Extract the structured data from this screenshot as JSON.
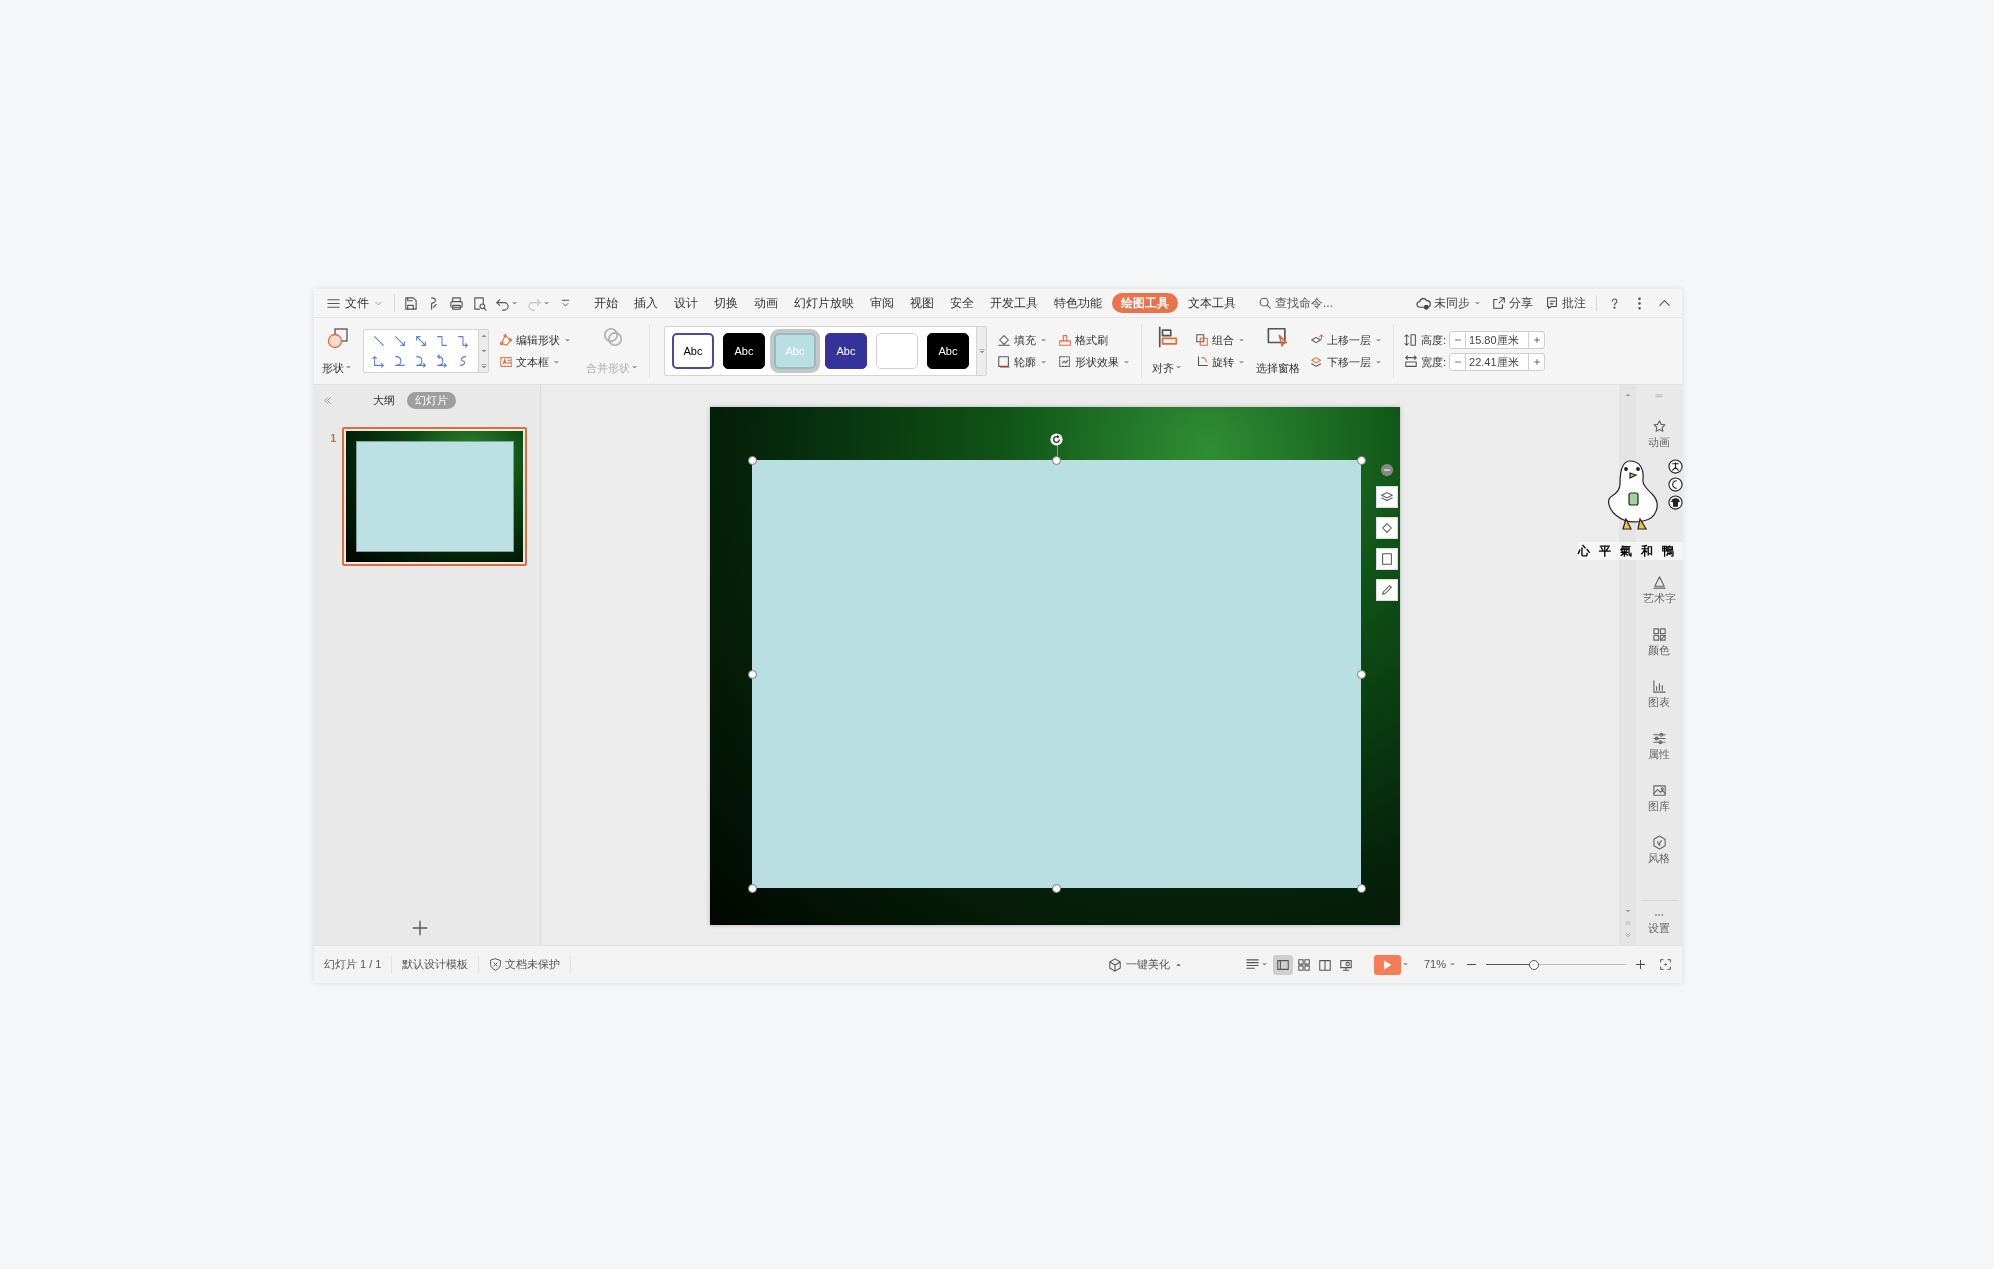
{
  "menu": {
    "file": "文件",
    "tabs": [
      {
        "label": "开始",
        "selected": false
      },
      {
        "label": "插入",
        "selected": false
      },
      {
        "label": "设计",
        "selected": false
      },
      {
        "label": "切换",
        "selected": false
      },
      {
        "label": "动画",
        "selected": false
      },
      {
        "label": "幻灯片放映",
        "selected": false
      },
      {
        "label": "审阅",
        "selected": false
      },
      {
        "label": "视图",
        "selected": false
      },
      {
        "label": "安全",
        "selected": false
      },
      {
        "label": "开发工具",
        "selected": false
      },
      {
        "label": "特色功能",
        "selected": false
      },
      {
        "label": "绘图工具",
        "selected": true
      },
      {
        "label": "文本工具",
        "selected": false
      }
    ],
    "search_placeholder": "查找命令...",
    "sync": "未同步",
    "share": "分享",
    "comment": "批注"
  },
  "ribbon": {
    "shape": "形状",
    "edit_shape": "编辑形状",
    "text_box": "文本框",
    "merge_shape": {
      "label": "合并形状",
      "disabled": true
    },
    "styles": [
      {
        "kind": "outline",
        "text": "Abc",
        "selected": false
      },
      {
        "kind": "black",
        "text": "Abc",
        "selected": false
      },
      {
        "kind": "light",
        "text": "Abc",
        "selected": true
      },
      {
        "kind": "navy",
        "text": "Abc",
        "selected": false
      },
      {
        "kind": "blank",
        "selected": false
      },
      {
        "kind": "black",
        "text": "Abc",
        "selected": false
      }
    ],
    "fill": "填充",
    "format_painter": "格式刷",
    "outline": "轮廓",
    "shape_effects": "形状效果",
    "align": "对齐",
    "group": "组合",
    "rotate": "旋转",
    "selection_pane": "选择窗格",
    "bring_forward": "上移一层",
    "send_backward": "下移一层",
    "height": {
      "label": "高度:",
      "value": "15.80厘米"
    },
    "width": {
      "label": "宽度:",
      "value": "22.41厘米"
    }
  },
  "left_panel": {
    "tabs": [
      {
        "label": "大纲",
        "selected": false
      },
      {
        "label": "幻灯片",
        "selected": true
      }
    ],
    "slides": [
      {
        "number": "1",
        "selected": true
      }
    ]
  },
  "right_sidebar": {
    "items": [
      "动画",
      "艺术字",
      "颜色",
      "图表",
      "属性",
      "图库",
      "风格"
    ],
    "settings": "设置"
  },
  "sticker": {
    "text": "心平氣和鴨"
  },
  "status_bar": {
    "slide": "幻灯片 1 / 1",
    "template": "默认设计模板",
    "protection": "文档未保护",
    "beautify": "一键美化",
    "view_modes": [
      {
        "selected": true
      },
      {
        "selected": false
      },
      {
        "selected": false
      },
      {
        "selected": false
      }
    ],
    "zoom": "71%",
    "zoom_slider": {
      "level": 0.34
    }
  }
}
